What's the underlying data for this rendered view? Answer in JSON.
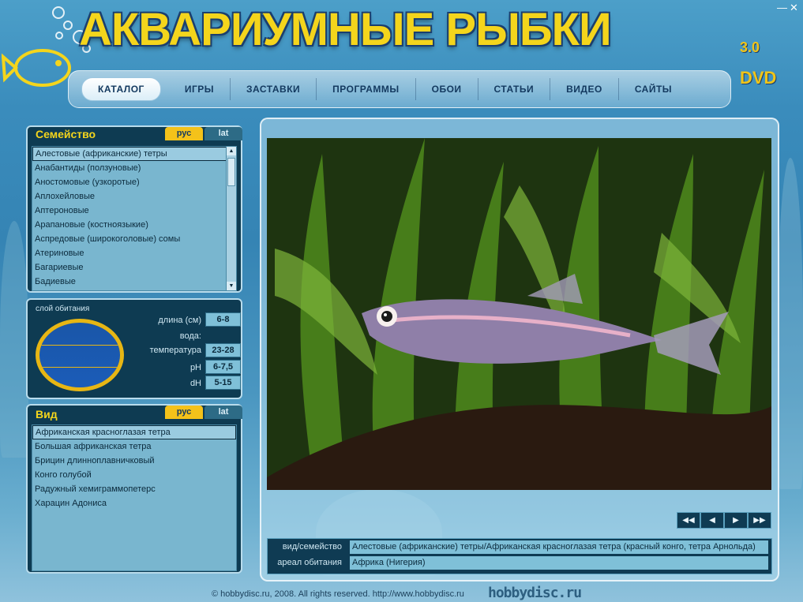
{
  "app": {
    "title": "АКВАРИУМНЫЕ РЫБКИ",
    "version": "3.0",
    "edition": "DVD"
  },
  "nav": {
    "items": [
      "КАТАЛОГ",
      "ИГРЫ",
      "ЗАСТАВКИ",
      "ПРОГРАММЫ",
      "ОБОИ",
      "СТАТЬИ",
      "ВИДЕО",
      "САЙТЫ"
    ],
    "active": "КАТАЛОГ"
  },
  "family": {
    "title": "Семейство",
    "tab_rus": "рус",
    "tab_lat": "lat",
    "items": [
      "Алестовые (африканские) тетры",
      "Анабантиды (ползуновые)",
      "Аностомовые (узкоротые)",
      "Аплохейловые",
      "Аптероновые",
      "Арапановые (костноязыкие)",
      "Аспредовые (широкоголовые) сомы",
      "Атериновые",
      "Багариевые",
      "Бадиевые"
    ],
    "selected": 0
  },
  "habitat": {
    "label": "слой обитания",
    "length_label": "длина (см)",
    "length_value": "6-8",
    "water_label": "вода:",
    "temp_label": "температура",
    "temp_value": "23-28",
    "ph_label": "pH",
    "ph_value": "6-7,5",
    "dh_label": "dH",
    "dh_value": "5-15"
  },
  "species": {
    "title": "Вид",
    "tab_rus": "рус",
    "tab_lat": "lat",
    "items": [
      "Африканская красноглазая тетра",
      "Большая африканская тетра",
      "Брицин длинноплавничковый",
      "Конго голубой",
      "Радужный хемиграммопетерс",
      "Харацин Адониса"
    ],
    "selected": 0
  },
  "info": {
    "species_family_label": "вид/семейство",
    "species_family_value": "Алестовые (африканские) тетры/Африканская красноглазая тетра (красный конго, тетра Арнольда)",
    "range_label": "ареал обитания",
    "range_value": "Африка (Нигерия)"
  },
  "footer": {
    "copyright": "© hobbydisc.ru, 2008. All rights reserved. http://www.hobbydisc.ru",
    "logo": "hobbydisc.ru"
  },
  "colors": {
    "accent_yellow": "#f4d51c",
    "panel_dark": "#0e3b52",
    "list_bg": "#79b6cf"
  }
}
